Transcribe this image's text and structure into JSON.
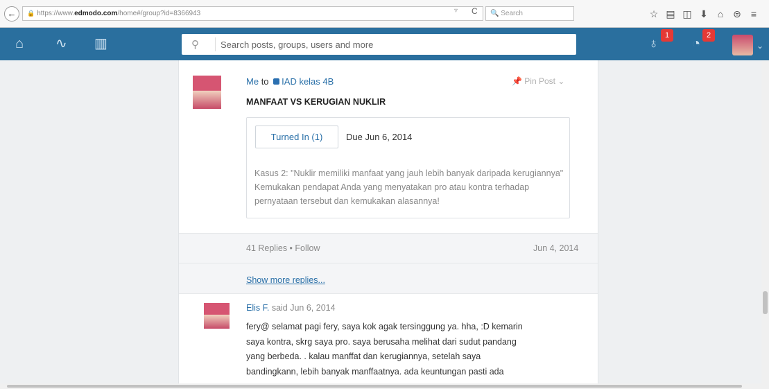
{
  "browser": {
    "back": "←",
    "url_prefix": "https://www.",
    "url_domain": "edmodo.com",
    "url_path": "/home#/group?id=8366943",
    "reload": "C",
    "search_placeholder": "Search",
    "toolbar_icons": [
      "star-icon",
      "reading-list-icon",
      "pocket-icon",
      "download-icon",
      "home-icon",
      "sync-icon",
      "menu-icon"
    ]
  },
  "nav": {
    "search_placeholder": "Search posts, groups, users and more",
    "notifications_count": "2",
    "backpack_count": "1",
    "accent": "#2a6f9e"
  },
  "post": {
    "author": "Me",
    "to": "to",
    "group": "IAD kelas 4B",
    "pin_label": "Pin Post",
    "title": "MANFAAT VS KERUGIAN NUKLIR",
    "turned_in": "Turned In (1)",
    "due": "Due Jun 6, 2014",
    "description": "Kasus 2: \"Nuklir memiliki manfaat yang jauh lebih banyak daripada kerugiannya\" Kemukakan pendapat Anda yang menyatakan pro atau kontra terhadap pernyataan tersebut dan kemukakan alasannya!",
    "replies": "41 Replies",
    "follow": "Follow",
    "date": "Jun 4, 2014",
    "show_more": "Show more replies..."
  },
  "comment": {
    "author": "Elis F.",
    "said": " said Jun 6, 2014",
    "lines": [
      "fery@ selamat pagi fery, saya kok agak tersinggung ya. hha, :D kemarin",
      "saya kontra, skrg saya pro. saya berusaha melihat dari sudut pandang",
      "yang berbeda. . kalau manffat dan kerugiannya, setelah saya",
      "bandingkann, lebih banyak manffaatnya. ada keuntungan pasti ada"
    ]
  }
}
